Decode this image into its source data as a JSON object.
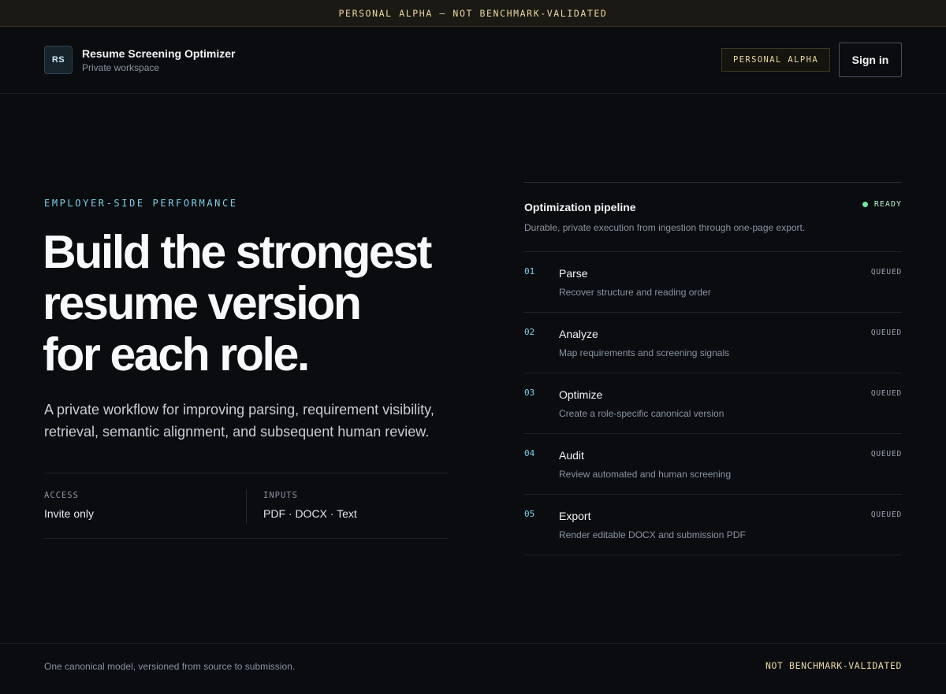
{
  "banner": {
    "text": "PERSONAL ALPHA — NOT BENCHMARK-VALIDATED"
  },
  "header": {
    "logo_initials": "RS",
    "app_title": "Resume Screening Optimizer",
    "workspace": "Private workspace",
    "alpha_badge": "PERSONAL ALPHA",
    "signin_label": "Sign in"
  },
  "hero": {
    "eyebrow": "EMPLOYER-SIDE PERFORMANCE",
    "headline_lines": [
      "Build the strongest",
      "resume version",
      "for each role."
    ],
    "lede": "A private workflow for improving parsing, requirement visibility, retrieval, semantic alignment, and subsequent human review.",
    "meta": [
      {
        "label": "ACCESS",
        "value": "Invite only"
      },
      {
        "label": "INPUTS",
        "value": "PDF · DOCX · Text"
      }
    ]
  },
  "pipeline": {
    "title": "Optimization pipeline",
    "subtitle": "Durable, private execution from ingestion through one-page export.",
    "status": "READY",
    "status_color": "#6ee7a0",
    "steps": [
      {
        "num": "01",
        "name": "Parse",
        "desc": "Recover structure and reading order",
        "status": "QUEUED"
      },
      {
        "num": "02",
        "name": "Analyze",
        "desc": "Map requirements and screening signals",
        "status": "QUEUED"
      },
      {
        "num": "03",
        "name": "Optimize",
        "desc": "Create a role-specific canonical version",
        "status": "QUEUED"
      },
      {
        "num": "04",
        "name": "Audit",
        "desc": "Review automated and human screening",
        "status": "QUEUED"
      },
      {
        "num": "05",
        "name": "Export",
        "desc": "Render editable DOCX and submission PDF",
        "status": "QUEUED"
      }
    ]
  },
  "footer": {
    "left": "One canonical model, versioned from source to submission.",
    "right": "NOT BENCHMARK-VALIDATED"
  }
}
